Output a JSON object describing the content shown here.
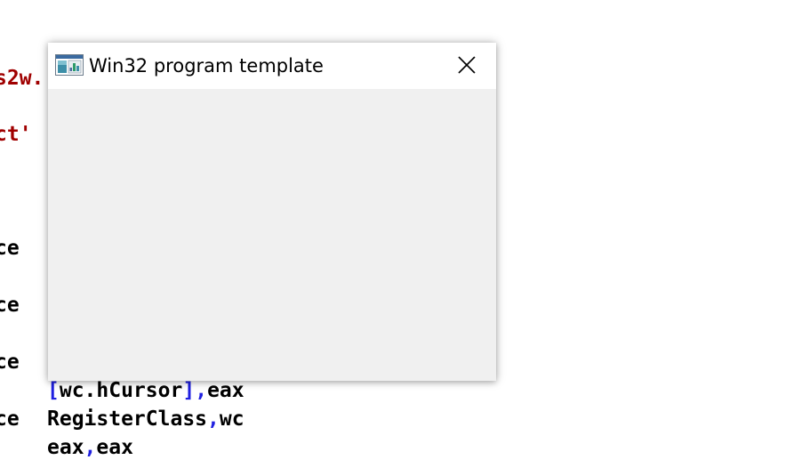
{
  "editor": {
    "lines": [
      {
        "segments": [
          {
            "text": "s2w.",
            "cls": "tok-str"
          }
        ]
      },
      {
        "segments": [
          {
            "text": "ct'",
            "cls": "tok-str"
          }
        ]
      },
      {
        "segments": [
          {
            "text": "ce",
            "cls": ""
          }
        ]
      },
      {
        "segments": [
          {
            "text": "ce",
            "cls": ""
          }
        ]
      },
      {
        "segments": [
          {
            "text": "ce",
            "cls": ""
          }
        ]
      },
      {
        "segments": [
          {
            "text": "[",
            "cls": "tok-punct"
          },
          {
            "text": "wc.hCursor",
            "cls": ""
          },
          {
            "text": "]",
            "cls": "tok-punct"
          },
          {
            "text": ",",
            "cls": "tok-punct"
          },
          {
            "text": "eax",
            "cls": ""
          }
        ]
      },
      {
        "segments": [
          {
            "text": "ce",
            "cls": ""
          }
        ]
      },
      {
        "segments": [
          {
            "text": "RegisterClass",
            "cls": ""
          },
          {
            "text": ",",
            "cls": "tok-punct"
          },
          {
            "text": "wc",
            "cls": ""
          }
        ]
      },
      {
        "segments": [
          {
            "text": "eax",
            "cls": ""
          },
          {
            "text": ",",
            "cls": "tok-punct"
          },
          {
            "text": "eax",
            "cls": ""
          }
        ]
      }
    ]
  },
  "window": {
    "title": "Win32 program template",
    "icon": "app-window-icon",
    "close_icon": "close-icon"
  },
  "colors": {
    "string": "#a00000",
    "punct": "#2020e0",
    "client_bg": "#f0f0f0",
    "title_bg": "#ffffff"
  }
}
